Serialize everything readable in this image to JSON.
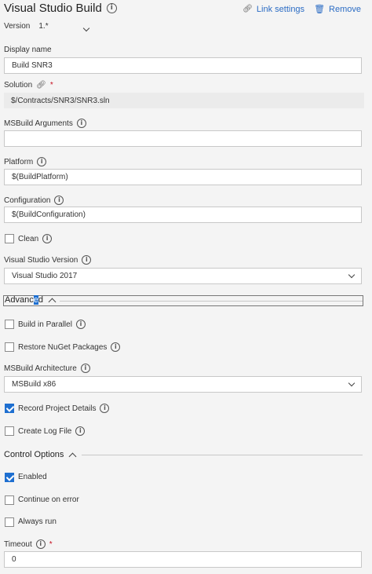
{
  "header": {
    "title": "Visual Studio Build",
    "link_settings": "Link settings",
    "remove": "Remove"
  },
  "version": {
    "label": "Version",
    "value": "1.*"
  },
  "display_name": {
    "label": "Display name",
    "value": "Build SNR3"
  },
  "solution": {
    "label": "Solution",
    "required": "*",
    "value": "$/Contracts/SNR3/SNR3.sln"
  },
  "msbuild_arguments": {
    "label": "MSBuild Arguments",
    "value": ""
  },
  "platform": {
    "label": "Platform",
    "value": "$(BuildPlatform)"
  },
  "configuration": {
    "label": "Configuration",
    "value": "$(BuildConfiguration)"
  },
  "clean": {
    "label": "Clean",
    "checked": false
  },
  "vs_version": {
    "label": "Visual Studio Version",
    "value": "Visual Studio 2017"
  },
  "advanced": {
    "title_a": "Advanc",
    "title_b": "e",
    "title_c": "d",
    "build_in_parallel": {
      "label": "Build in Parallel",
      "checked": false
    },
    "restore_nuget": {
      "label": "Restore NuGet Packages",
      "checked": false
    },
    "msbuild_arch": {
      "label": "MSBuild Architecture",
      "value": "MSBuild x86"
    },
    "record_project_details": {
      "label": "Record Project Details",
      "checked": true
    },
    "create_log_file": {
      "label": "Create Log File",
      "checked": false
    }
  },
  "control_options": {
    "title": "Control Options",
    "enabled": {
      "label": "Enabled",
      "checked": true
    },
    "continue_on_error": {
      "label": "Continue on error",
      "checked": false
    },
    "always_run": {
      "label": "Always run",
      "checked": false
    },
    "timeout": {
      "label": "Timeout",
      "required": "*",
      "value": "0"
    }
  },
  "colors": {
    "accent": "#1e6fd0",
    "link": "#2b6cc4",
    "required": "#c50f1f"
  },
  "icons": [
    "info-icon",
    "link-icon",
    "remove-icon",
    "chevron-down-icon",
    "chevron-up-icon",
    "check-icon"
  ]
}
